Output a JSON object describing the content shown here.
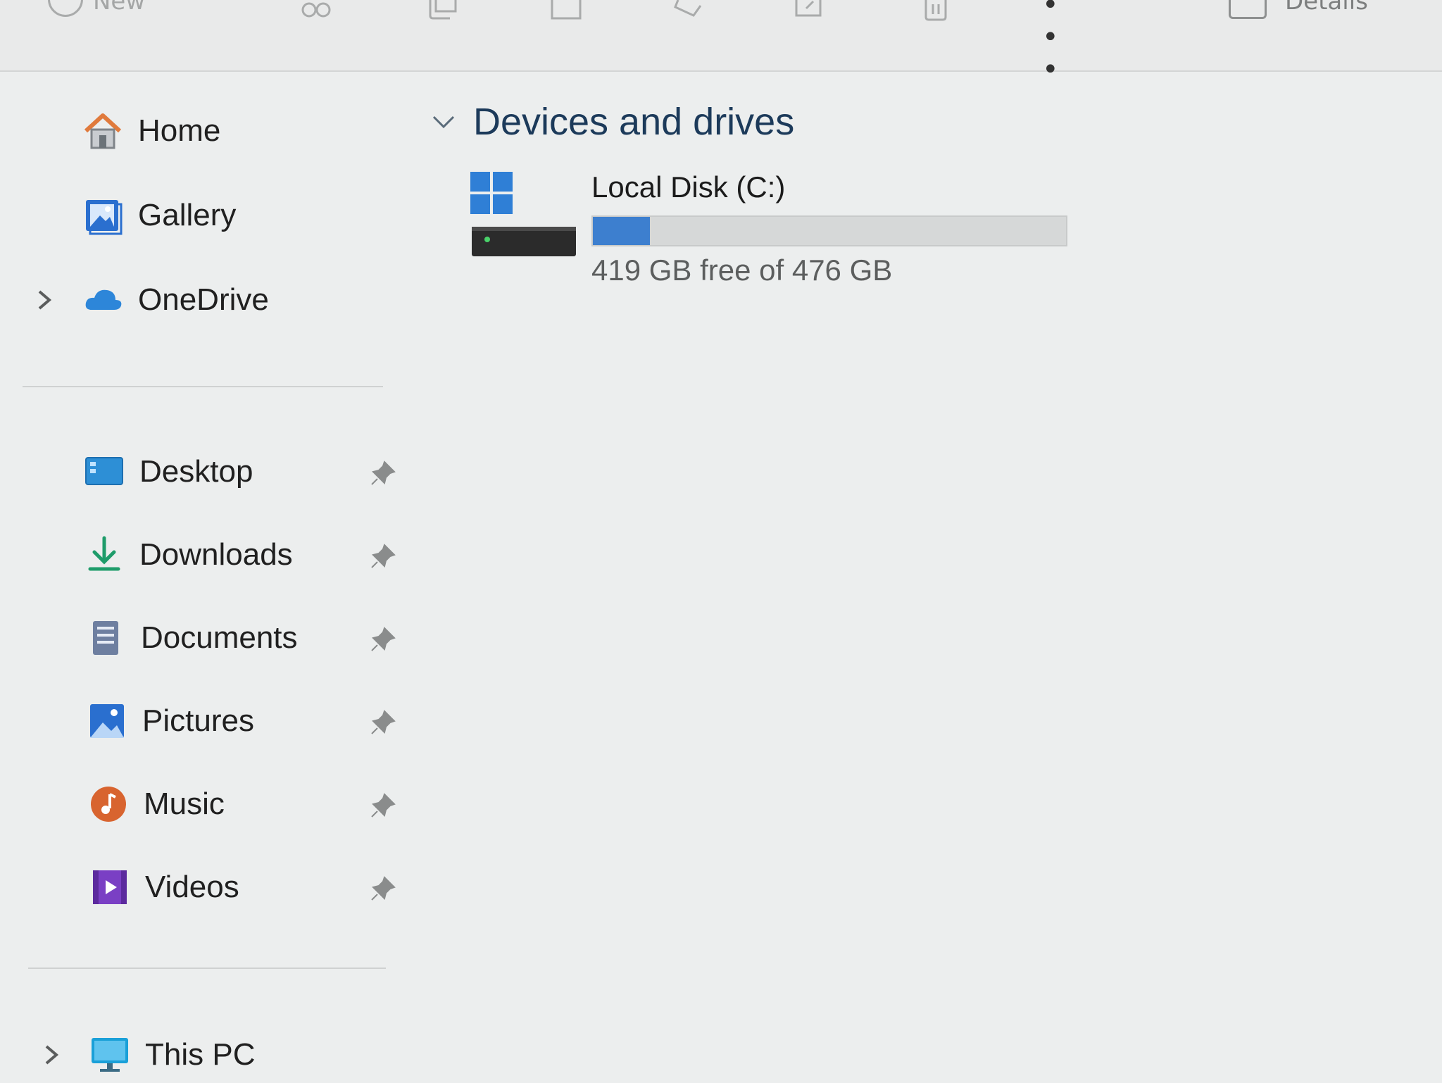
{
  "toolbar": {
    "new_label": "New",
    "more_label": "• • •",
    "details_label": "Details",
    "icons": [
      "new-icon",
      "cut-icon",
      "copy-icon",
      "paste-icon",
      "rename-icon",
      "share-icon",
      "delete-icon"
    ]
  },
  "sidebar": {
    "top_items": [
      {
        "label": "Home",
        "icon": "home-icon",
        "expandable": false
      },
      {
        "label": "Gallery",
        "icon": "gallery-icon",
        "expandable": false
      },
      {
        "label": "OneDrive",
        "icon": "onedrive-icon",
        "expandable": true
      }
    ],
    "pinned_items": [
      {
        "label": "Desktop",
        "icon": "desktop-icon"
      },
      {
        "label": "Downloads",
        "icon": "downloads-icon"
      },
      {
        "label": "Documents",
        "icon": "documents-icon"
      },
      {
        "label": "Pictures",
        "icon": "pictures-icon"
      },
      {
        "label": "Music",
        "icon": "music-icon"
      },
      {
        "label": "Videos",
        "icon": "videos-icon"
      }
    ],
    "bottom_items": [
      {
        "label": "This PC",
        "icon": "this-pc-icon",
        "expandable": true
      }
    ]
  },
  "main": {
    "section_title": "Devices and drives",
    "drives": [
      {
        "name": "Local Disk (C:)",
        "free_text": "419 GB free of 476 GB",
        "used_fraction": 0.12,
        "icon": "windows-drive-icon"
      }
    ]
  },
  "colors": {
    "accent": "#3d7fcf",
    "background": "#eceeee"
  }
}
